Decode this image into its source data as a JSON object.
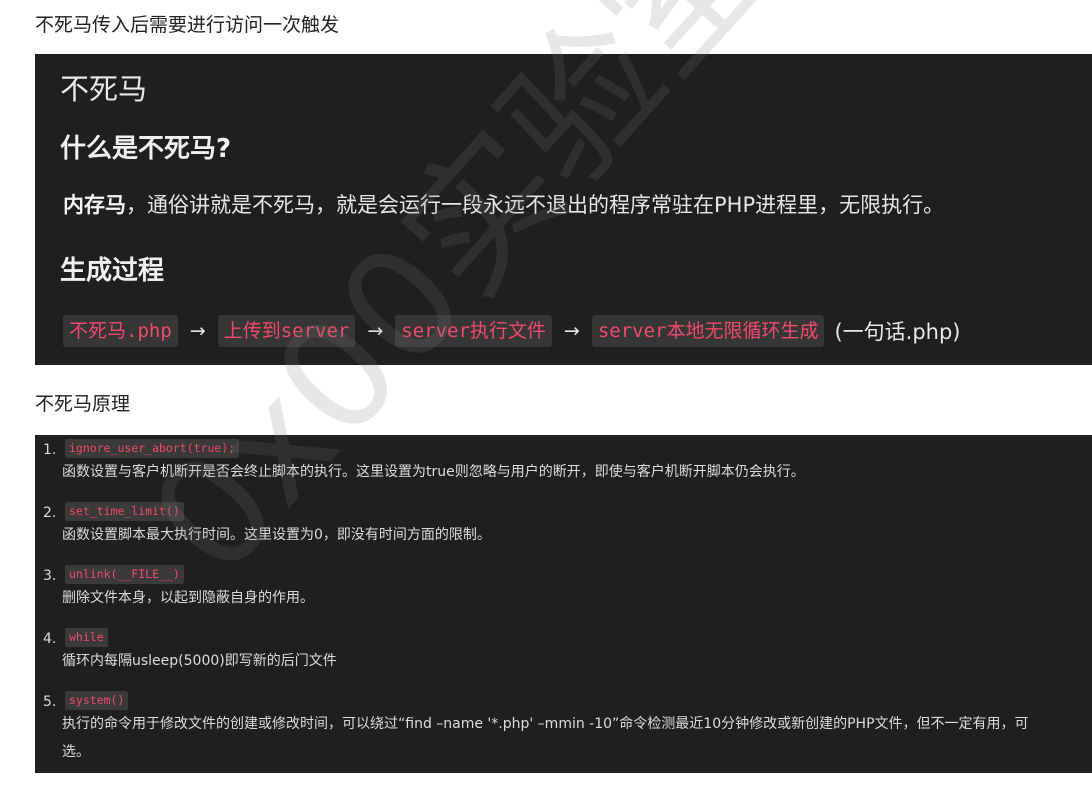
{
  "headings": {
    "top": "不死马传入后需要进行访问一次触发",
    "middle": "不死马原理"
  },
  "block1": {
    "title": "不死马",
    "h2_what": "什么是不死马?",
    "para_bold": "内存马",
    "para_rest": "，通俗讲就是不死马，就是会运行一段永远不退出的程序常驻在PHP进程里，无限执行。",
    "h2_process": "生成过程",
    "flow": [
      "不死马.php",
      "上传到server",
      "server执行文件",
      "server本地无限循环生成"
    ],
    "arrow": "→",
    "flow_end": "(一句话.php)"
  },
  "principles": [
    {
      "num": "1.",
      "code": "ignore_user_abort(true);",
      "desc": "函数设置与客户机断开是否会终止脚本的执行。这里设置为true则忽略与用户的断开，即使与客户机断开脚本仍会执行。"
    },
    {
      "num": "2.",
      "code": "set_time_limit()",
      "desc": "函数设置脚本最大执行时间。这里设置为0，即没有时间方面的限制。"
    },
    {
      "num": "3.",
      "code": "unlink(__FILE__)",
      "desc": "删除文件本身，以起到隐蔽自身的作用。"
    },
    {
      "num": "4.",
      "code": "while",
      "desc": "循环内每隔usleep(5000)即写新的后门文件"
    },
    {
      "num": "5.",
      "code": "system()",
      "desc": "执行的命令用于修改文件的创建或修改时间，可以绕过“find –name '*.php' –mmin -10”命令检测最近10分钟修改或新创建的PHP文件，但不一定有用，可选。"
    }
  ],
  "watermark": "0x00实验室"
}
